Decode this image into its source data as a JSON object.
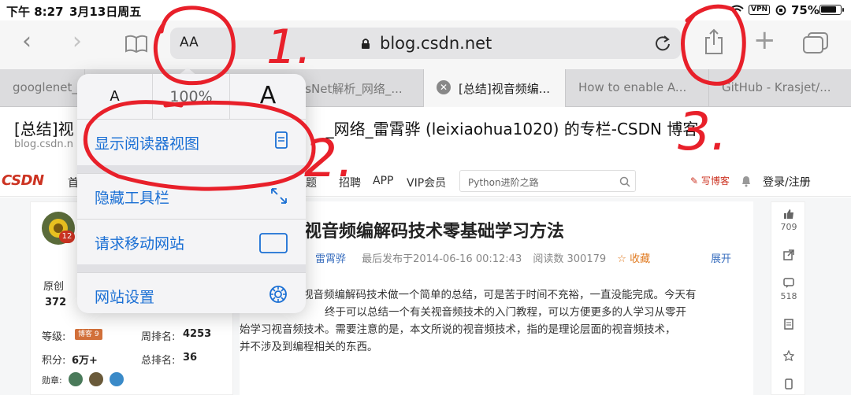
{
  "status": {
    "time": "下午 8:27",
    "date": "3月13日周五",
    "vpn": "VPN",
    "battery": "75%"
  },
  "toolbar": {
    "back": "‹",
    "forward": "›",
    "text_size": "AA",
    "url": "blog.csdn.net",
    "plus": "+"
  },
  "tabs": [
    {
      "label": "googlenet_"
    },
    {
      "label": "esNet解析_网络_..."
    },
    {
      "label": "[总结]视音频编..."
    },
    {
      "label": "How to enable A..."
    },
    {
      "label": "GitHub - Krasjet/..."
    }
  ],
  "page": {
    "title_prefix": "[总结]视",
    "title_suffix": "_网络_雷霄骅 (leixiaohua1020) 的专栏-CSDN 博客",
    "domain": "blog.csdn.n"
  },
  "csdn_nav": {
    "logo": "CSDN",
    "home": "首",
    "items": [
      "题",
      "招聘",
      "APP",
      "VIP会员"
    ],
    "search_placeholder": "Python进阶之路",
    "write": "写博客",
    "login": "登录/注册"
  },
  "sidebar": {
    "level_badge": "12",
    "original_label": "原创",
    "original_count": "372",
    "grade_label": "等级:",
    "grade_badge": "博客 9",
    "week_rank_label": "周排名:",
    "week_rank": "4253",
    "points_label": "积分:",
    "points": "6万+",
    "total_rank_label": "总排名:",
    "total_rank": "36",
    "medal_label": "勋章:"
  },
  "article": {
    "title": "视音频编解码技术零基础学习方法",
    "author": "雷霄骅",
    "published": "最后发布于2014-06-16 00:12:43",
    "reads": "阅读数 300179",
    "favorite": "收藏",
    "expand": "展开",
    "body_line1": "视音频编解码技术做一个简单的总结，可是苦于时间不充裕，一直没能完成。今天有",
    "body_line2": "终于可以总结一个有关视音频技术的入门教程，可以方便更多的人学习从零开",
    "body_line3": "始学习视音频技术。需要注意的是，本文所说的视音频技术，指的是理论层面的视音频技术，",
    "body_line4": "并不涉及到编程相关的东西。"
  },
  "rail": {
    "likes": "709",
    "comments": "518"
  },
  "popover": {
    "zoom_small": "A",
    "zoom_level": "100%",
    "zoom_large": "A",
    "reader_view": "显示阅读器视图",
    "hide_toolbar": "隐藏工具栏",
    "request_mobile": "请求移动网站",
    "website_settings": "网站设置"
  },
  "annotations": {
    "n1": "1.",
    "n2": "2.",
    "n3": "3."
  },
  "colors": {
    "ios_blue": "#1a6fd4",
    "annotation_red": "#e8202a",
    "csdn_red": "#cc3322"
  }
}
